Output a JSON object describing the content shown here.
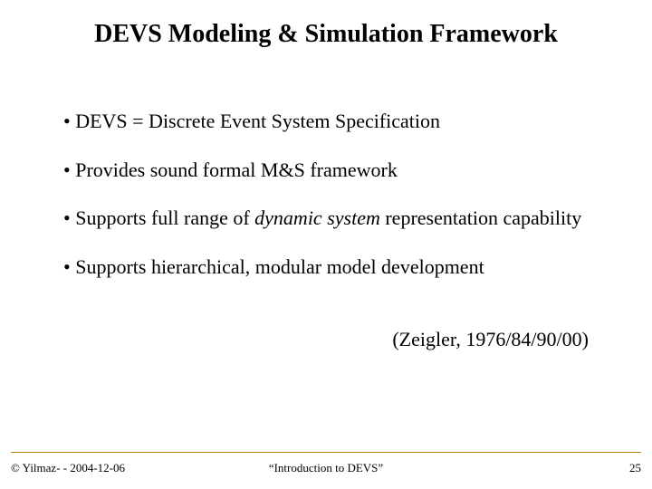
{
  "title": "DEVS Modeling & Simulation Framework",
  "bullets": {
    "b1": "•  DEVS = Discrete Event System Specification",
    "b2": "• Provides sound formal M&S framework",
    "b3_pre": "• Supports full range of ",
    "b3_em": "dynamic  system",
    "b3_post": " representation capability",
    "b4": "• Supports hierarchical, modular model development"
  },
  "citation": "(Zeigler, 1976/84/90/00)",
  "footer": {
    "left": "© Yilmaz- -  2004-12-06",
    "center": "“Introduction to DEVS”",
    "right": "25"
  }
}
